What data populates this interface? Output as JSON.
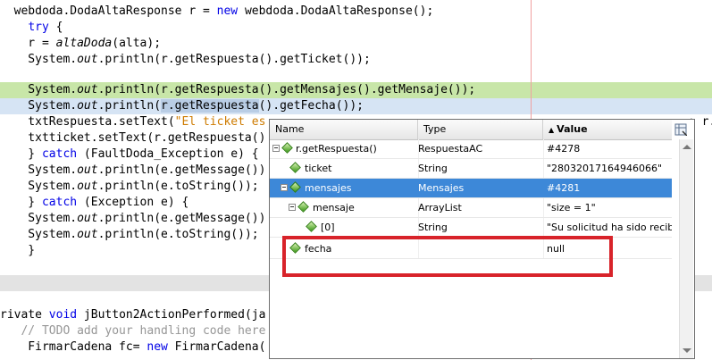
{
  "editor": {
    "lines": {
      "l1": {
        "a": "  webdoda.DodaAltaResponse r = ",
        "kw": "new",
        "b": " webdoda.DodaAltaResponse();"
      },
      "l2": {
        "kw": "try",
        "b": " {"
      },
      "l3": {
        "a": "    r = ",
        "it": "altaDoda",
        "b": "(alta);"
      },
      "l4": {
        "a": "    System.",
        "out": "out",
        "b": ".println(r.getRespuesta().getTicket());"
      },
      "l6": {
        "a": "    System.",
        "out": "out",
        "b": ".println(r.getRespuesta().getMensajes().getMensaje());"
      },
      "l7": {
        "a": "    System.",
        "out": "out",
        "b": ".println(",
        "sel": "r.getRespuesta",
        "c": "().getFecha());"
      },
      "l8": {
        "a": "    txtRespuesta.setText(",
        "str": "\"El ticket es",
        "tail": "+ r."
      },
      "l9": {
        "a": "    txtticket.setText(r.getRespuesta()"
      },
      "l10": {
        "a": "    } ",
        "kw": "catch",
        "b": " (FaultDoda_Exception e) {"
      },
      "l11": {
        "a": "    System.",
        "out": "out",
        "b": ".println(e.getMessage())"
      },
      "l12": {
        "a": "    System.",
        "out": "out",
        "b": ".println(e.toString());"
      },
      "l13": {
        "a": "    } ",
        "kw": "catch",
        "b": " (Exception e) {"
      },
      "l14": {
        "a": "    System.",
        "out": "out",
        "b": ".println(e.getMessage())"
      },
      "l15": {
        "a": "    System.",
        "out": "out",
        "b": ".println(e.toString());"
      },
      "l16": {
        "a": "    }"
      },
      "l19": {
        "a": "rivate ",
        "kw": "void",
        "b": " jButton2ActionPerformed(ja"
      },
      "l20": {
        "cm": "   // TODO add your handling code here"
      },
      "l21": {
        "a": "    FirmarCadena fc= ",
        "kw": "new",
        "b": " FirmarCadena("
      }
    }
  },
  "debugger": {
    "headers": {
      "name": "Name",
      "type": "Type",
      "value": "Value"
    },
    "sort_icon": "triangle-up-icon",
    "corner_icon": "table-columns-icon",
    "rows": [
      {
        "name": "r.getRespuesta()",
        "type": "RespuestaAC",
        "value": "#4278",
        "icon": "diamond-icon",
        "expanded": true
      },
      {
        "name": "ticket",
        "type": "String",
        "value": "\"28032017164946066\"",
        "icon": "diamond-icon"
      },
      {
        "name": "mensajes",
        "type": "Mensajes",
        "value": "#4281",
        "icon": "diamond-icon",
        "expanded": true,
        "selected": true
      },
      {
        "name": "mensaje",
        "type": "ArrayList",
        "value": "\"size = 1\"",
        "icon": "diamond-icon",
        "expanded": true
      },
      {
        "name": "[0]",
        "type": "String",
        "value": "\"Su solicitud ha sido recibi…",
        "icon": "diamond-icon"
      },
      {
        "name": "fecha",
        "type": "",
        "value": "null",
        "icon": "diamond-icon"
      }
    ]
  },
  "colors": {
    "highlight_box": "#d8232a",
    "selected_row": "#3d88d8",
    "current_line": "#c8e6a8",
    "selection": "#d6e4f4"
  }
}
